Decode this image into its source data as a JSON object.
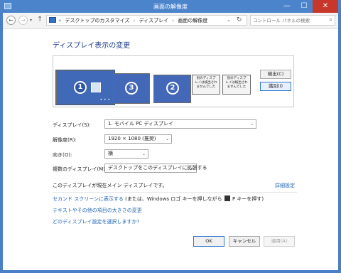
{
  "window": {
    "title": "画面の解像度",
    "min": "—",
    "max": "☐",
    "close": "✕"
  },
  "nav": {
    "back": "←",
    "forward": "→",
    "dropdown": "▾",
    "up": "↑",
    "crumbs": [
      "«",
      "デスクトップのカスタマイズ",
      "›",
      "ディスプレイ",
      "›",
      "画面の解像度"
    ],
    "address_dropdown": "⌄",
    "refresh": "↻",
    "search_placeholder": "コントロール パネルの検索",
    "search_icon": "⌕"
  },
  "heading": "ディスプレイ表示の変更",
  "monitors": [
    {
      "num": "1"
    },
    {
      "num": "3"
    },
    {
      "num": "2"
    },
    {
      "text": "別のディスプ\nレイは検出され\nませんでした"
    },
    {
      "text": "別のディスプ\nレイは検出され\nませんでした"
    }
  ],
  "monitor_dots": "• • •",
  "buttons": {
    "detect": "検出(C)",
    "identify": "識別(I)",
    "ok": "OK",
    "cancel": "キャンセル",
    "apply": "適用(A)"
  },
  "form": {
    "display": {
      "label": "ディスプレイ(S):",
      "value": "1. モバイル PC ディスプレイ"
    },
    "resolution": {
      "label": "解像度(R):",
      "value": "1920 × 1080 (推奨)"
    },
    "orientation": {
      "label": "向き(O):",
      "value": "横"
    },
    "multiple": {
      "label": "複数のディスプレイ(M):",
      "value": "デスクトップをこのディスプレイに拡張する"
    },
    "chevron": "⌄"
  },
  "status": "このディスプレイが現在メイン ディスプレイです。",
  "advanced_link": "詳細設定",
  "project_line": {
    "link": "セカンド スクリーンに表示する",
    "pre": " (または、Windows ロゴ キーを押しながら ",
    "post": " P キーを押す)"
  },
  "text_size_link": "テキストやその他の項目の大きさの変更",
  "which_settings_link": "どのディスプレイ設定を選択しますか?"
}
